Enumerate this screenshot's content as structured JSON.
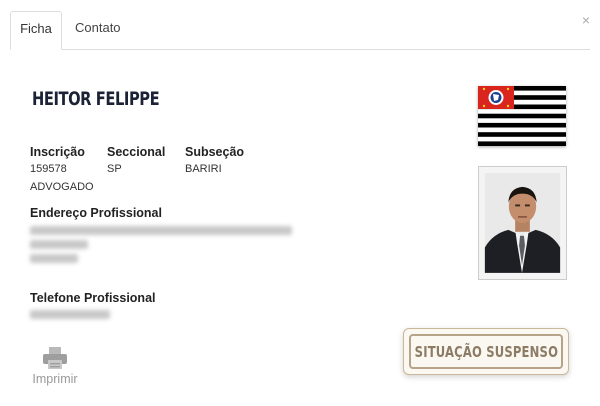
{
  "tabs": [
    {
      "label": "Ficha",
      "active": true
    },
    {
      "label": "Contato",
      "active": false
    }
  ],
  "close_glyph": "×",
  "profile": {
    "name": "HEITOR FELIPPE",
    "inscricao_label": "Inscrição",
    "inscricao_value": "159578",
    "seccional_label": "Seccional",
    "seccional_value": "SP",
    "subsecao_label": "Subseção",
    "subsecao_value": "BARIRI",
    "tipo": "ADVOGADO",
    "endereco_label": "Endereço Profissional",
    "telefone_label": "Telefone Profissional"
  },
  "status_stamp": "SITUAÇÃO SUSPENSO",
  "print_label": "Imprimir",
  "colors": {
    "name_color": "#1c2235",
    "stamp_border": "#b6a48a",
    "stamp_text": "#8c7c66",
    "flag_red": "#d9251d",
    "flag_blue": "#1c3f94"
  },
  "icons": {
    "close": "close-icon",
    "print": "printer-icon",
    "flag": "sao-paulo-flag-icon"
  }
}
